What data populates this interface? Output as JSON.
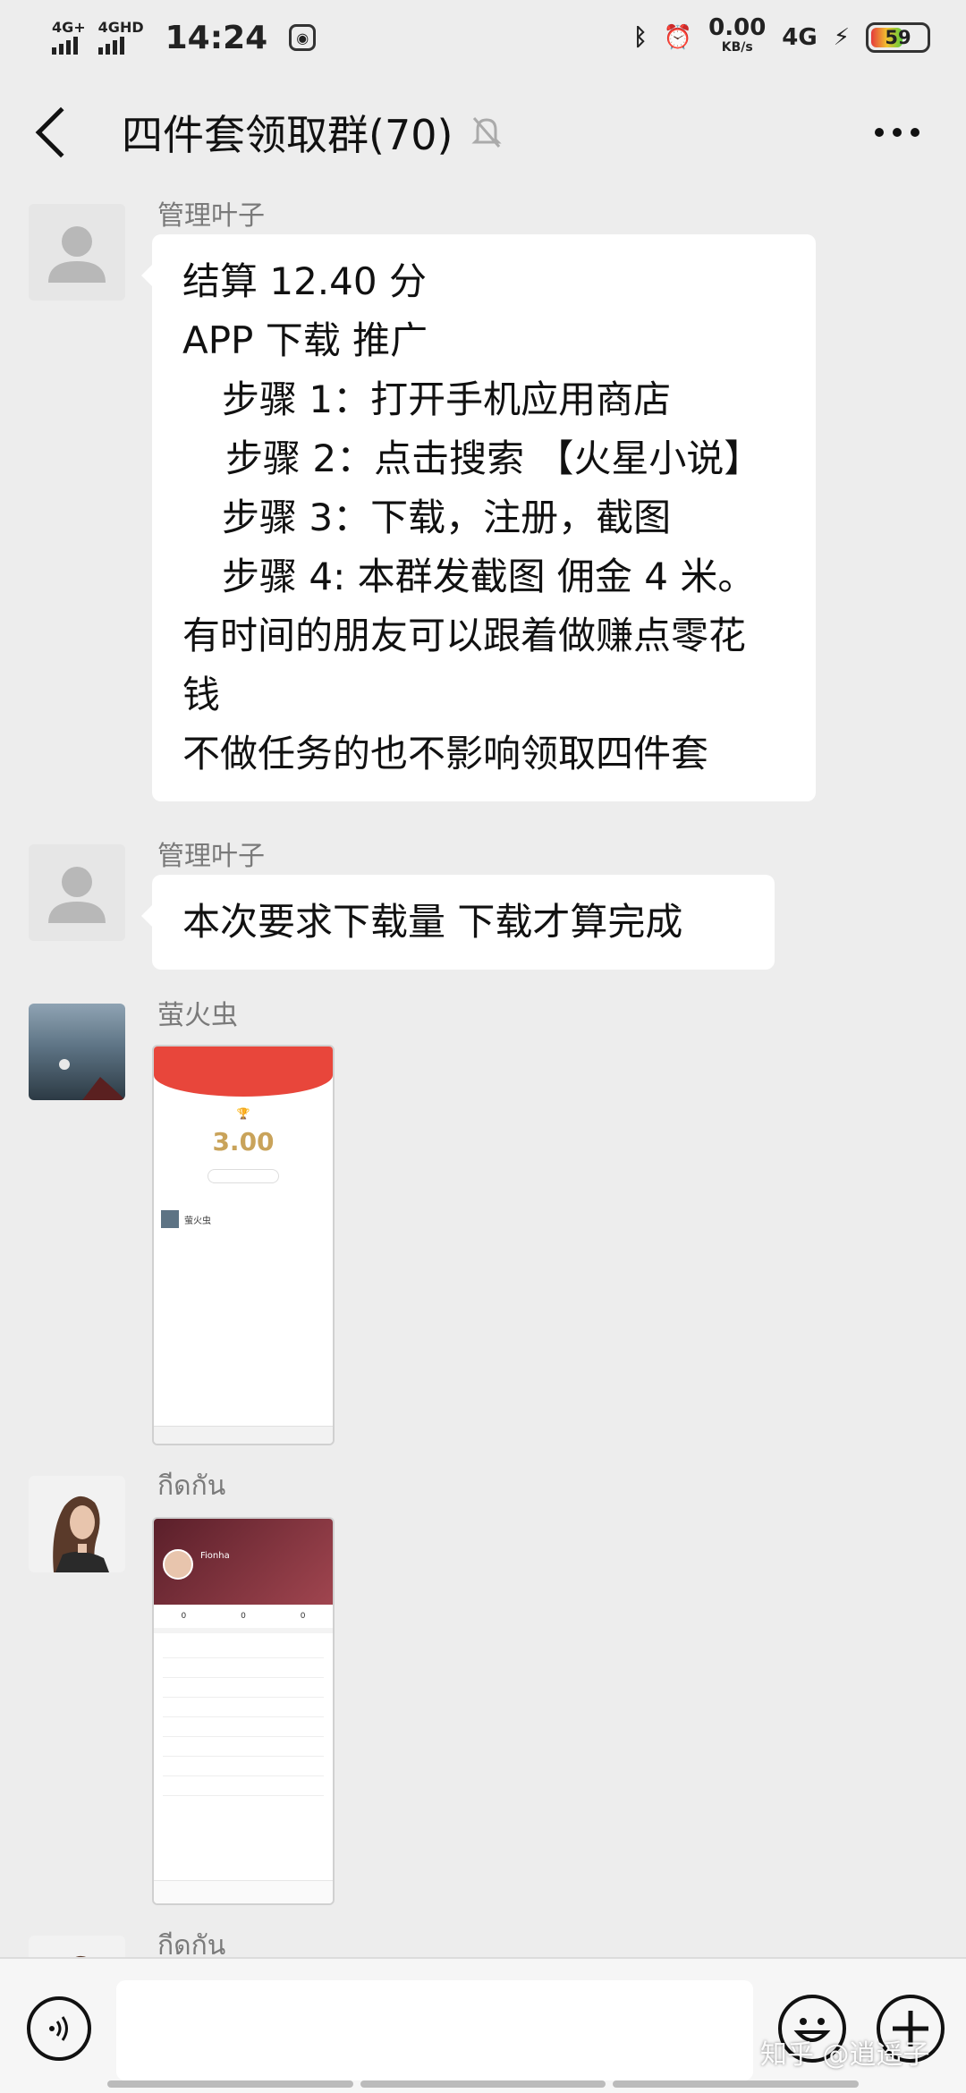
{
  "status_bar": {
    "signal1": "4G+",
    "signal2": "4GHD",
    "time": "14:24",
    "net_speed": "0.00",
    "net_unit": "KB/s",
    "net_type": "4G",
    "battery": "59"
  },
  "header": {
    "title": "四件套领取群(70)"
  },
  "messages": [
    {
      "sender": "管理叶子",
      "lines": [
        "结算 12.40 分",
        "APP 下载 推广",
        "步骤 1：打开手机应用商店",
        "步骤 2：点击搜索 【火星小说】",
        "步骤 3：下载，注册，截图",
        "步骤 4: 本群发截图 佣金 4 米。",
        "有时间的朋友可以跟着做赚点零花",
        "钱",
        "不做任务的也不影响领取四件套"
      ]
    },
    {
      "sender": "管理叶子",
      "text": "本次要求下载量   下载才算完成"
    },
    {
      "sender": "萤火虫",
      "image": {
        "amount": "3.00",
        "user": "萤火虫"
      }
    },
    {
      "sender": "กีดกัน",
      "image": {
        "name": "Fionha"
      }
    },
    {
      "sender": "กีดกัน"
    }
  ],
  "watermark": "知乎 @逍遥子"
}
